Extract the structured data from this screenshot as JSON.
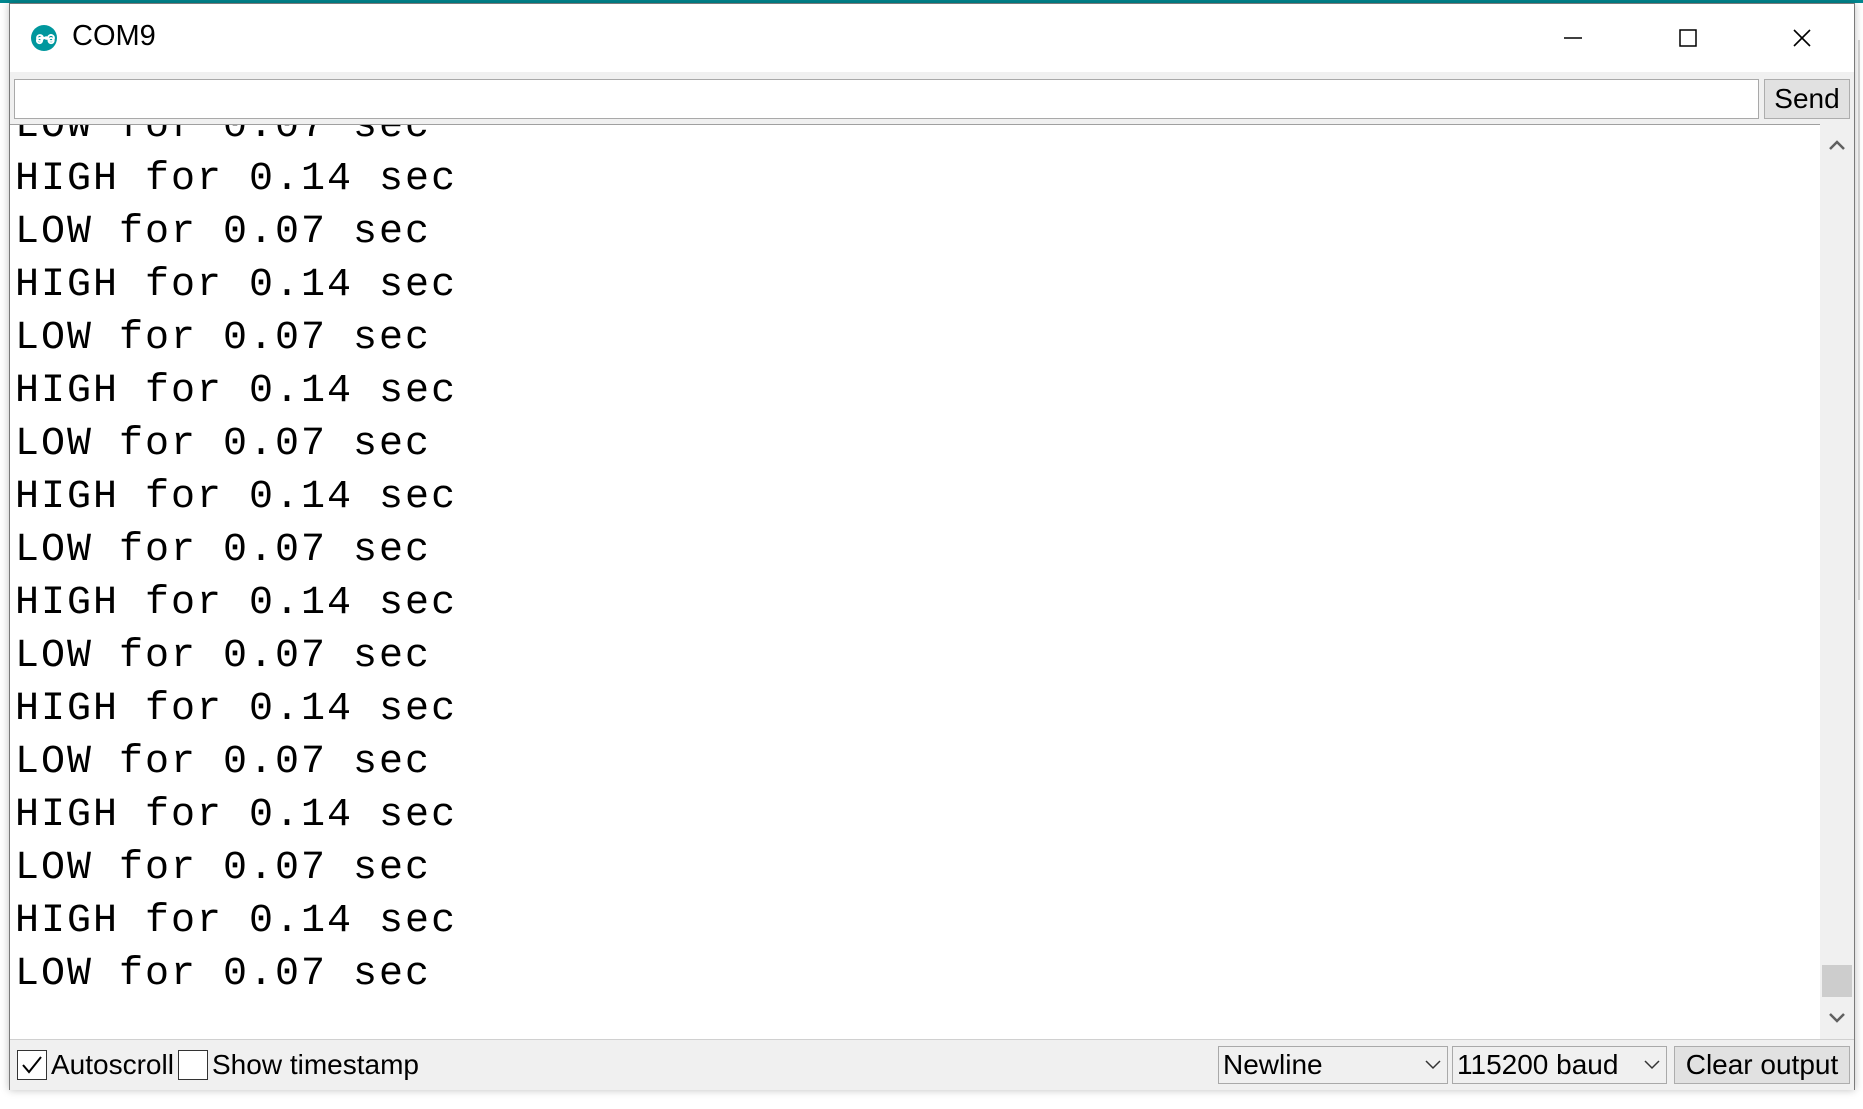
{
  "window": {
    "title": "COM9",
    "app_icon": "arduino-infinity-icon"
  },
  "input": {
    "value": "",
    "placeholder": "",
    "send_label": "Send"
  },
  "output": {
    "partial_top_line": "LOW for 0.07 sec",
    "lines": [
      "HIGH for 0.14 sec",
      "LOW for 0.07 sec",
      "HIGH for 0.14 sec",
      "LOW for 0.07 sec",
      "HIGH for 0.14 sec",
      "LOW for 0.07 sec",
      "HIGH for 0.14 sec",
      "LOW for 0.07 sec",
      "HIGH for 0.14 sec",
      "LOW for 0.07 sec",
      "HIGH for 0.14 sec",
      "LOW for 0.07 sec",
      "HIGH for 0.14 sec",
      "LOW for 0.07 sec",
      "HIGH for 0.14 sec",
      "LOW for 0.07 sec"
    ]
  },
  "status": {
    "autoscroll_label": "Autoscroll",
    "autoscroll_checked": true,
    "timestamp_label": "Show timestamp",
    "timestamp_checked": false,
    "line_ending": "Newline",
    "baud": "115200 baud",
    "clear_label": "Clear output"
  },
  "colors": {
    "accent": "#00878f",
    "window_bg": "#f0f0f0",
    "output_bg": "#ffffff"
  }
}
